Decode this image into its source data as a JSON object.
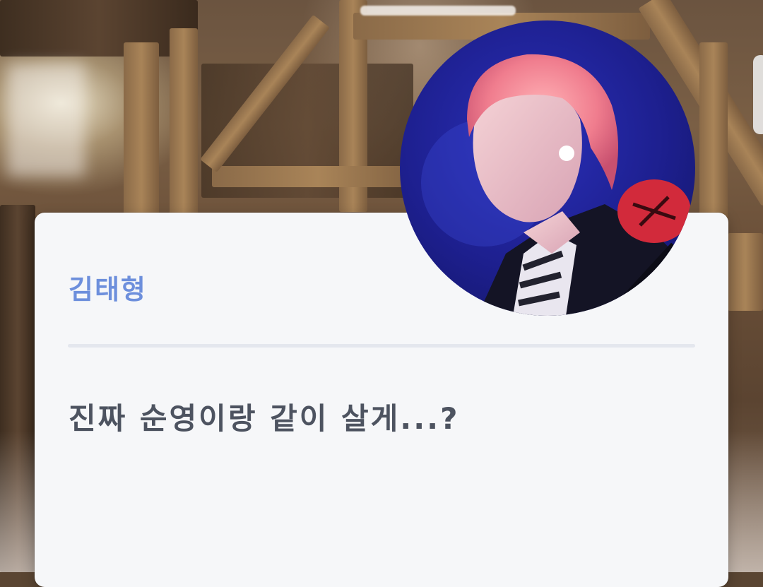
{
  "profile": {
    "name": "김태형",
    "message": "진짜 순영이랑 같이 살게...?"
  },
  "colors": {
    "name_text": "#6d8fdc",
    "message_text": "#4d5360",
    "card_bg": "#f6f7f9",
    "divider": "#e4e7ee"
  },
  "icons": {
    "avatar": "profile-photo"
  }
}
